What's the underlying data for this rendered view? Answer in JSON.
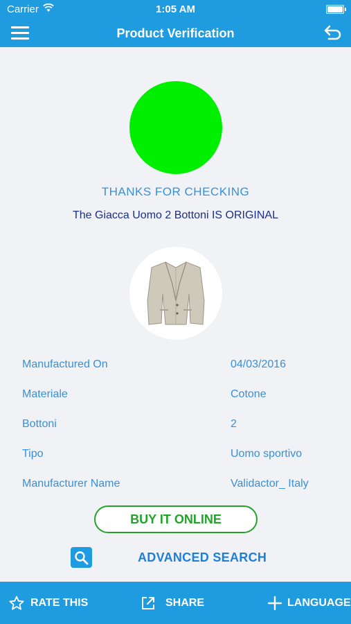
{
  "status_bar": {
    "carrier": "Carrier",
    "time": "1:05 AM"
  },
  "nav": {
    "title": "Product Verification",
    "menu_icon": "hamburger-icon",
    "back_icon": "back-arrow-icon"
  },
  "verification": {
    "status_color": "#00ee00",
    "thanks_text": "THANKS FOR CHECKING",
    "result_text": "The Giacca Uomo 2 Bottoni IS ORIGINAL"
  },
  "details": [
    {
      "label": "Manufactured On",
      "value": "04/03/2016"
    },
    {
      "label": "Materiale",
      "value": "Cotone"
    },
    {
      "label": "Bottoni",
      "value": "2"
    },
    {
      "label": "Tipo",
      "value": "Uomo sportivo"
    },
    {
      "label": "Manufacturer Name",
      "value": "Validactor_ Italy"
    }
  ],
  "actions": {
    "buy_label": "BUY IT ONLINE",
    "advanced_search_label": "ADVANCED SEARCH"
  },
  "tab_bar": {
    "rate_label": "RATE THIS",
    "share_label": "SHARE",
    "language_label": "LANGUAGE"
  },
  "colors": {
    "primary": "#1f9be0",
    "success": "#22a32a",
    "background": "#f0f2f5"
  }
}
